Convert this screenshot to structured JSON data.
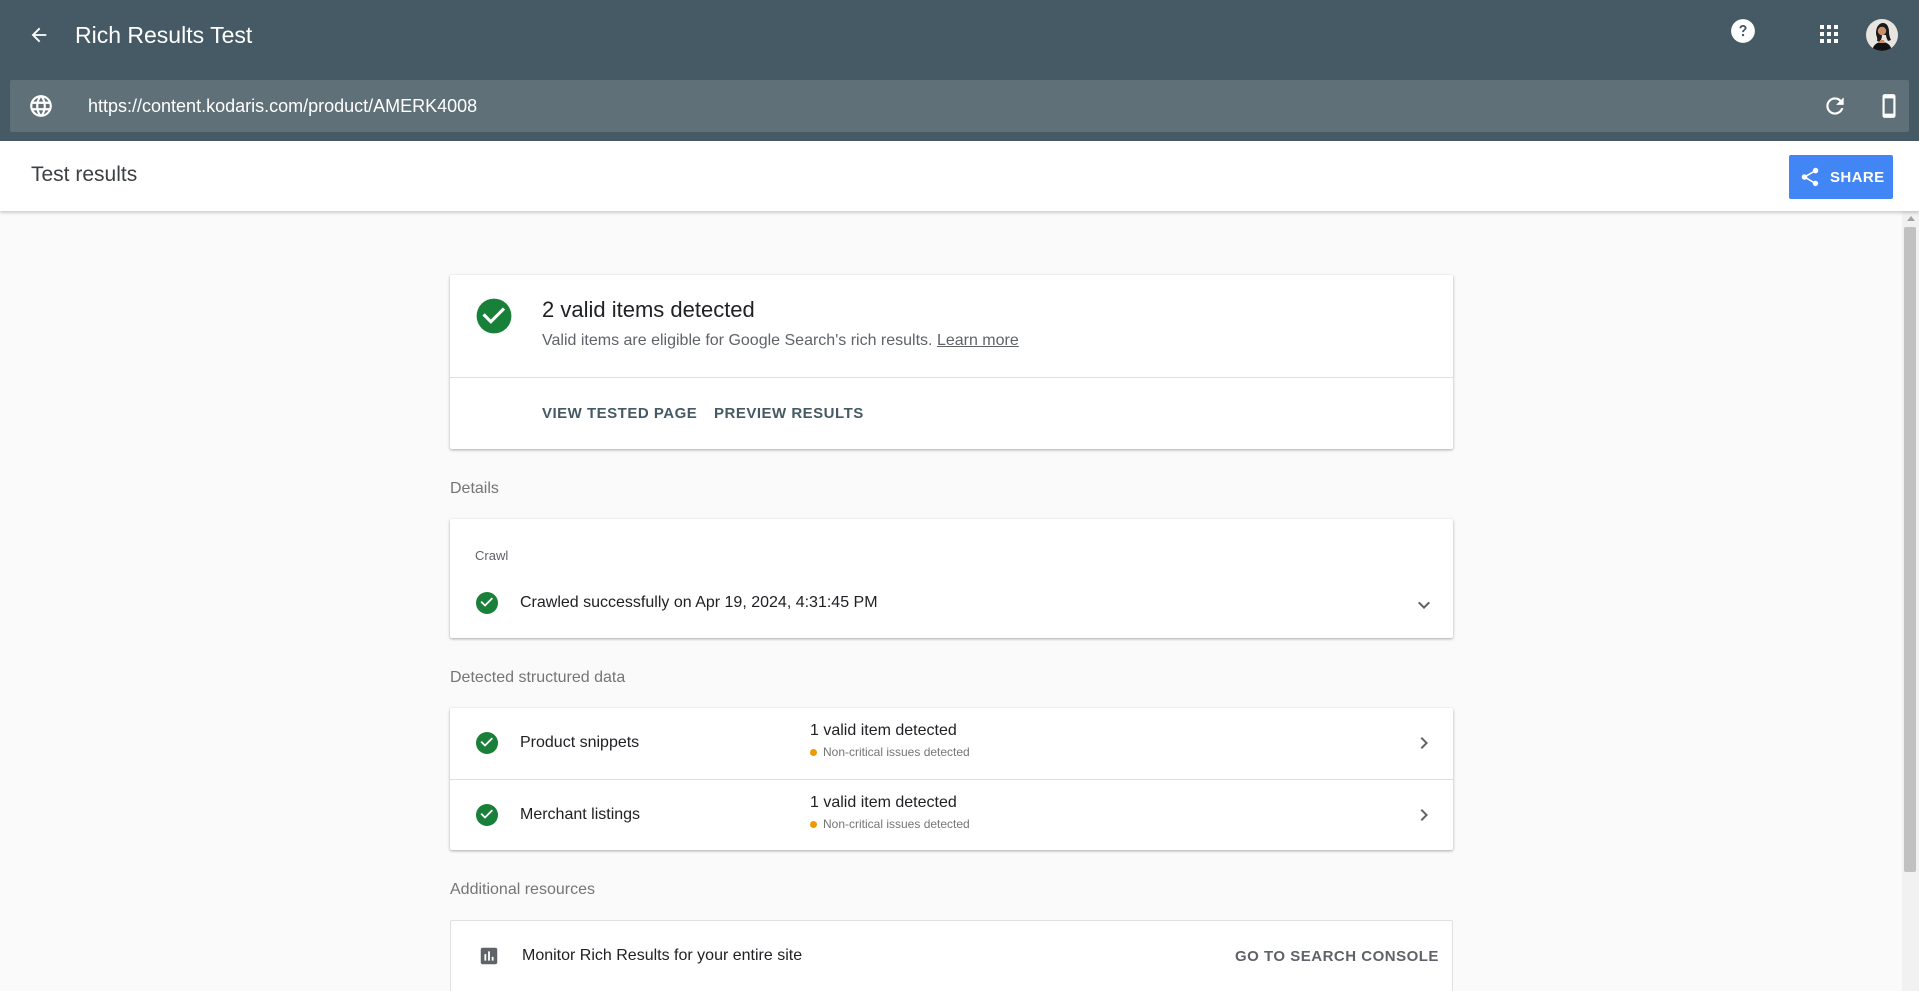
{
  "header": {
    "title": "Rich Results Test",
    "url": "https://content.kodaris.com/product/AMERK4008"
  },
  "subheader": {
    "title": "Test results",
    "share_label": "SHARE"
  },
  "summary": {
    "title": "2 valid items detected",
    "subtitle": "Valid items are eligible for Google Search's rich results.",
    "learn_more": "Learn more",
    "view_tested_page": "VIEW TESTED PAGE",
    "preview_results": "PREVIEW RESULTS"
  },
  "details": {
    "section_label": "Details",
    "crawl_label": "Crawl",
    "crawl_status": "Crawled successfully on Apr 19, 2024, 4:31:45 PM"
  },
  "structured_data": {
    "section_label": "Detected structured data",
    "items": [
      {
        "label": "Product snippets",
        "status": "1 valid item detected",
        "note": "Non-critical issues detected"
      },
      {
        "label": "Merchant listings",
        "status": "1 valid item detected",
        "note": "Non-critical issues detected"
      }
    ]
  },
  "resources": {
    "section_label": "Additional resources",
    "monitor_text": "Monitor Rich Results for your entire site",
    "console_link": "GO TO SEARCH CONSOLE"
  },
  "colors": {
    "header_bg": "#455a64",
    "urlbar_bg": "#607078",
    "success_green": "#188038",
    "share_blue": "#4285f4",
    "warning_orange": "#f29900"
  },
  "icons": {
    "back": "arrow-back-icon",
    "help": "help-icon",
    "apps": "apps-grid-icon",
    "globe": "globe-icon",
    "refresh": "refresh-icon",
    "device": "smartphone-icon",
    "share": "share-icon",
    "success": "check-circle-icon",
    "expand": "chevron-down-icon",
    "open": "chevron-right-icon",
    "chart": "bar-chart-icon"
  }
}
